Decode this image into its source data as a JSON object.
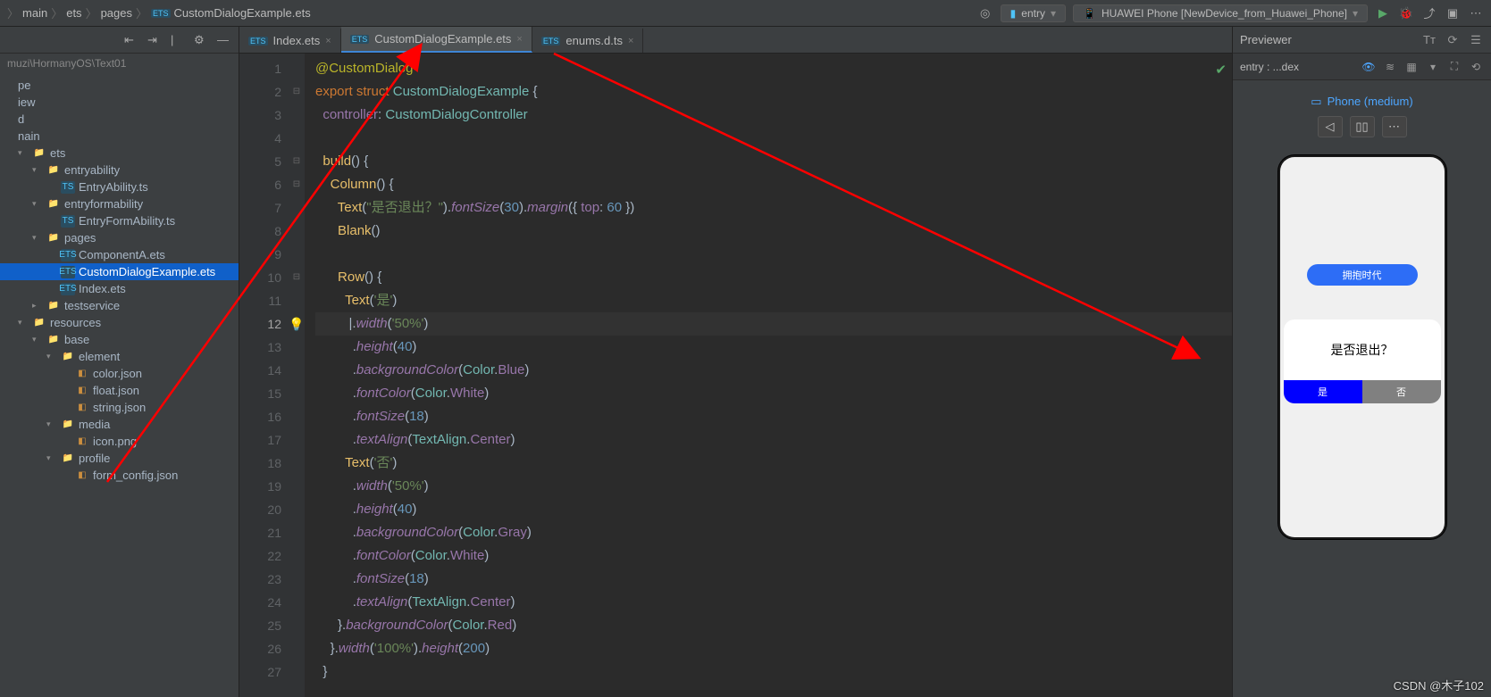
{
  "breadcrumbs": [
    "main",
    "ets",
    "pages",
    "CustomDialogExample.ets"
  ],
  "toolbar": {
    "entry": "entry",
    "device": "HUAWEI Phone [NewDevice_from_Huawei_Phone]"
  },
  "sidebar": {
    "project_path": "muzi\\HormanyOS\\Text01",
    "items": [
      {
        "indent": 0,
        "caret": "",
        "icon": "",
        "label": "pe"
      },
      {
        "indent": 0,
        "caret": "",
        "icon": "",
        "label": "iew"
      },
      {
        "indent": 0,
        "caret": "",
        "icon": "",
        "label": "d"
      },
      {
        "indent": 0,
        "caret": "",
        "icon": "",
        "label": "nain"
      },
      {
        "indent": 1,
        "caret": "▾",
        "icon": "fld",
        "label": "ets"
      },
      {
        "indent": 2,
        "caret": "▾",
        "icon": "fld",
        "label": "entryability"
      },
      {
        "indent": 3,
        "caret": "",
        "icon": "ts",
        "label": "EntryAbility.ts"
      },
      {
        "indent": 2,
        "caret": "▾",
        "icon": "fld",
        "label": "entryformability"
      },
      {
        "indent": 3,
        "caret": "",
        "icon": "ts",
        "label": "EntryFormAbility.ts"
      },
      {
        "indent": 2,
        "caret": "▾",
        "icon": "fld",
        "label": "pages"
      },
      {
        "indent": 3,
        "caret": "",
        "icon": "ets",
        "label": "ComponentA.ets"
      },
      {
        "indent": 3,
        "caret": "",
        "icon": "ets",
        "label": "CustomDialogExample.ets",
        "sel": true
      },
      {
        "indent": 3,
        "caret": "",
        "icon": "ets",
        "label": "Index.ets"
      },
      {
        "indent": 2,
        "caret": "▸",
        "icon": "fld",
        "label": "testservice"
      },
      {
        "indent": 1,
        "caret": "▾",
        "icon": "fld",
        "label": "resources"
      },
      {
        "indent": 2,
        "caret": "▾",
        "icon": "fld",
        "label": "base"
      },
      {
        "indent": 3,
        "caret": "▾",
        "icon": "fld",
        "label": "element"
      },
      {
        "indent": 4,
        "caret": "",
        "icon": "jsn",
        "label": "color.json"
      },
      {
        "indent": 4,
        "caret": "",
        "icon": "jsn",
        "label": "float.json"
      },
      {
        "indent": 4,
        "caret": "",
        "icon": "jsn",
        "label": "string.json"
      },
      {
        "indent": 3,
        "caret": "▾",
        "icon": "fld",
        "label": "media"
      },
      {
        "indent": 4,
        "caret": "",
        "icon": "jsn",
        "label": "icon.png"
      },
      {
        "indent": 3,
        "caret": "▾",
        "icon": "fld",
        "label": "profile"
      },
      {
        "indent": 4,
        "caret": "",
        "icon": "jsn",
        "label": "form_config.json"
      }
    ]
  },
  "tabs": [
    {
      "label": "Index.ets",
      "active": false
    },
    {
      "label": "CustomDialogExample.ets",
      "active": true
    },
    {
      "label": "enums.d.ts",
      "active": false
    }
  ],
  "code": {
    "lines": [
      {
        "n": 1,
        "html": "<span class='ann'>@CustomDialog</span>"
      },
      {
        "n": 2,
        "html": "<span class='kw'>export</span> <span class='kw'>struct</span> <span class='type'>CustomDialogExample</span> <span class='pl'>{</span>"
      },
      {
        "n": 3,
        "html": "  <span class='prop'>controller</span><span class='pl'>:</span> <span class='type'>CustomDialogController</span>"
      },
      {
        "n": 4,
        "html": ""
      },
      {
        "n": 5,
        "html": "  <span class='fn'>build</span><span class='pl'>() {</span>"
      },
      {
        "n": 6,
        "html": "    <span class='fn'>Column</span><span class='pl'>() {</span>"
      },
      {
        "n": 7,
        "html": "      <span class='fn'>Text</span><span class='pl'>(</span><span class='str'>\"是否退出？\"</span><span class='pl'>).</span><span class='fn2'>fontSize</span><span class='pl'>(</span><span class='num'>30</span><span class='pl'>).</span><span class='fn2'>margin</span><span class='pl'>({ </span><span class='prop'>top</span><span class='pl'>: </span><span class='num'>60</span><span class='pl'> })</span>"
      },
      {
        "n": 8,
        "html": "      <span class='fn'>Blank</span><span class='pl'>()</span>"
      },
      {
        "n": 9,
        "html": ""
      },
      {
        "n": 10,
        "html": "      <span class='fn'>Row</span><span class='pl'>() {</span>"
      },
      {
        "n": 11,
        "html": "        <span class='fn'>Text</span><span class='pl'>(</span><span class='str'>'是'</span><span class='pl'>)</span>"
      },
      {
        "n": 12,
        "html": "         <span class='pl'>|</span><span class='pl'>.</span><span class='fn2'>width</span><span class='pl'>(</span><span class='str'>'50%'</span><span class='pl'>)</span>",
        "cur": true
      },
      {
        "n": 13,
        "html": "          <span class='pl'>.</span><span class='fn2'>height</span><span class='pl'>(</span><span class='num'>40</span><span class='pl'>)</span>"
      },
      {
        "n": 14,
        "html": "          <span class='pl'>.</span><span class='fn2'>backgroundColor</span><span class='pl'>(</span><span class='type'>Color</span><span class='pl'>.</span><span class='prop'>Blue</span><span class='pl'>)</span>"
      },
      {
        "n": 15,
        "html": "          <span class='pl'>.</span><span class='fn2'>fontColor</span><span class='pl'>(</span><span class='type'>Color</span><span class='pl'>.</span><span class='prop'>White</span><span class='pl'>)</span>"
      },
      {
        "n": 16,
        "html": "          <span class='pl'>.</span><span class='fn2'>fontSize</span><span class='pl'>(</span><span class='num'>18</span><span class='pl'>)</span>"
      },
      {
        "n": 17,
        "html": "          <span class='pl'>.</span><span class='fn2'>textAlign</span><span class='pl'>(</span><span class='type'>TextAlign</span><span class='pl'>.</span><span class='prop'>Center</span><span class='pl'>)</span>"
      },
      {
        "n": 18,
        "html": "        <span class='fn'>Text</span><span class='pl'>(</span><span class='str'>'否'</span><span class='pl'>)</span>"
      },
      {
        "n": 19,
        "html": "          <span class='pl'>.</span><span class='fn2'>width</span><span class='pl'>(</span><span class='str'>'50%'</span><span class='pl'>)</span>"
      },
      {
        "n": 20,
        "html": "          <span class='pl'>.</span><span class='fn2'>height</span><span class='pl'>(</span><span class='num'>40</span><span class='pl'>)</span>"
      },
      {
        "n": 21,
        "html": "          <span class='pl'>.</span><span class='fn2'>backgroundColor</span><span class='pl'>(</span><span class='type'>Color</span><span class='pl'>.</span><span class='prop'>Gray</span><span class='pl'>)</span>"
      },
      {
        "n": 22,
        "html": "          <span class='pl'>.</span><span class='fn2'>fontColor</span><span class='pl'>(</span><span class='type'>Color</span><span class='pl'>.</span><span class='prop'>White</span><span class='pl'>)</span>"
      },
      {
        "n": 23,
        "html": "          <span class='pl'>.</span><span class='fn2'>fontSize</span><span class='pl'>(</span><span class='num'>18</span><span class='pl'>)</span>"
      },
      {
        "n": 24,
        "html": "          <span class='pl'>.</span><span class='fn2'>textAlign</span><span class='pl'>(</span><span class='type'>TextAlign</span><span class='pl'>.</span><span class='prop'>Center</span><span class='pl'>)</span>"
      },
      {
        "n": 25,
        "html": "      <span class='pl'>}.</span><span class='fn2'>backgroundColor</span><span class='pl'>(</span><span class='type'>Color</span><span class='pl'>.</span><span class='prop'>Red</span><span class='pl'>)</span>"
      },
      {
        "n": 26,
        "html": "    <span class='pl'>}.</span><span class='fn2'>width</span><span class='pl'>(</span><span class='str'>'100%'</span><span class='pl'>).</span><span class='fn2'>height</span><span class='pl'>(</span><span class='num'>200</span><span class='pl'>)</span>"
      },
      {
        "n": 27,
        "html": "  <span class='pl'>}</span>"
      }
    ]
  },
  "preview": {
    "title": "Previewer",
    "entry": "entry : ...dex",
    "device_label": "Phone (medium)",
    "app_button": "拥抱时代",
    "dialog_text": "是否退出？",
    "yes": "是",
    "no": "否"
  },
  "watermark": "CSDN @木子102"
}
